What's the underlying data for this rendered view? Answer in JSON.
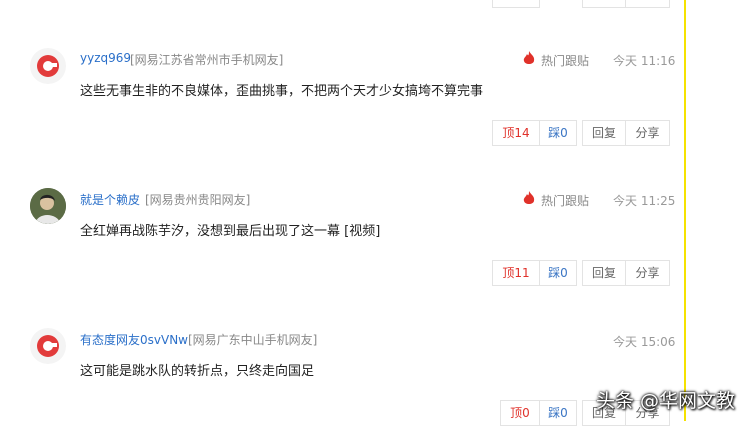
{
  "comments": [
    {
      "username": "yyzq969",
      "location": "[网易江苏省常州市手机网友]",
      "hot_label": "热门跟贴",
      "time": "今天 11:16",
      "text": "这些无事生非的不良媒体，歪曲挑事，不把两个天才少女搞垮不算完事",
      "up": "顶14",
      "down": "踩0",
      "reply": "回复",
      "share": "分享"
    },
    {
      "username": "就是个赖皮",
      "location": "[网易贵州贵阳网友]",
      "hot_label": "热门跟贴",
      "time": "今天 11:25",
      "text": "全红婵再战陈芋汐，没想到最后出现了这一幕 [视频]",
      "up": "顶11",
      "down": "踩0",
      "reply": "回复",
      "share": "分享"
    },
    {
      "username": "有态度网友0svVNw",
      "location": "[网易广东中山手机网友]",
      "time": "今天 15:06",
      "text": "这可能是跳水队的转折点，只终走向国足",
      "up": "顶0",
      "down": "踩0",
      "reply": "回复",
      "share": "分享"
    }
  ],
  "watermark": "头条 @华网文教",
  "colors": {
    "accent_red": "#e0312a",
    "link_blue": "#2a6fc9",
    "rule_yellow": "#f5e200"
  }
}
